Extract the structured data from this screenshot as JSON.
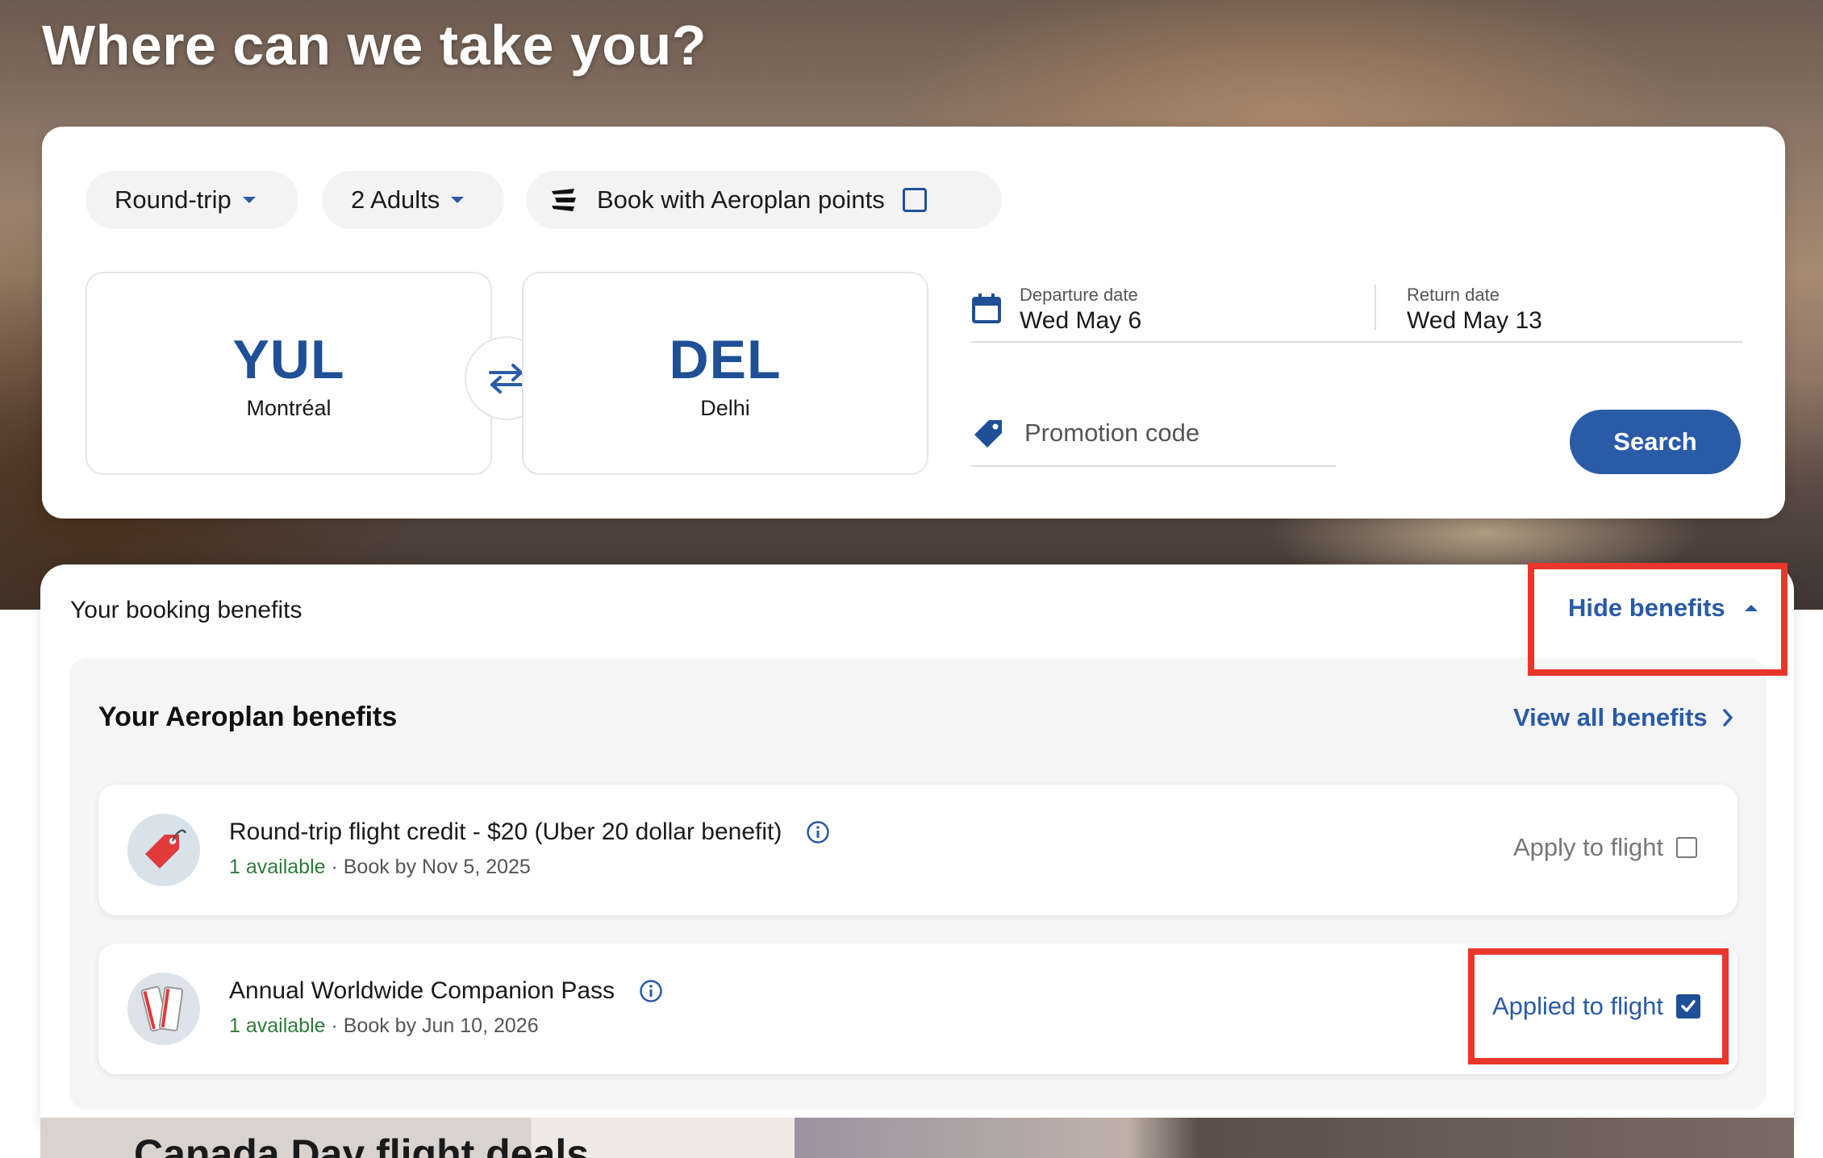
{
  "hero": {
    "title": "Where can we take you?"
  },
  "search": {
    "trip_type": "Round-trip",
    "passengers": "2 Adults",
    "aeroplan_points_label": "Book with Aeroplan points",
    "aeroplan_points_checked": false,
    "origin": {
      "code": "YUL",
      "city": "Montréal"
    },
    "destination": {
      "code": "DEL",
      "city": "Delhi"
    },
    "departure": {
      "label": "Departure date",
      "value": "Wed May 6"
    },
    "return": {
      "label": "Return date",
      "value": "Wed May 13"
    },
    "promo_placeholder": "Promotion code",
    "search_label": "Search"
  },
  "benefits": {
    "heading": "Your booking benefits",
    "toggle_label": "Hide benefits",
    "aeroplan_heading": "Your Aeroplan benefits",
    "view_all_label": "View all benefits",
    "items": [
      {
        "title": "Round-trip flight credit - $20 (Uber 20 dollar benefit)",
        "available": "1 available",
        "book_by": " · Book by Nov 5, 2025",
        "action_label": "Apply to flight",
        "checked": false
      },
      {
        "title": "Annual Worldwide Companion Pass",
        "available": "1 available",
        "book_by": " · Book by Jun 10, 2026",
        "action_label": "Applied to flight",
        "checked": true
      }
    ]
  },
  "deals": {
    "title": "Canada Day flight deals"
  },
  "colors": {
    "brand_blue": "#2a5ba6",
    "code_blue": "#1f4f96",
    "available_green": "#2f7a3a",
    "highlight_red": "#e8372a"
  }
}
